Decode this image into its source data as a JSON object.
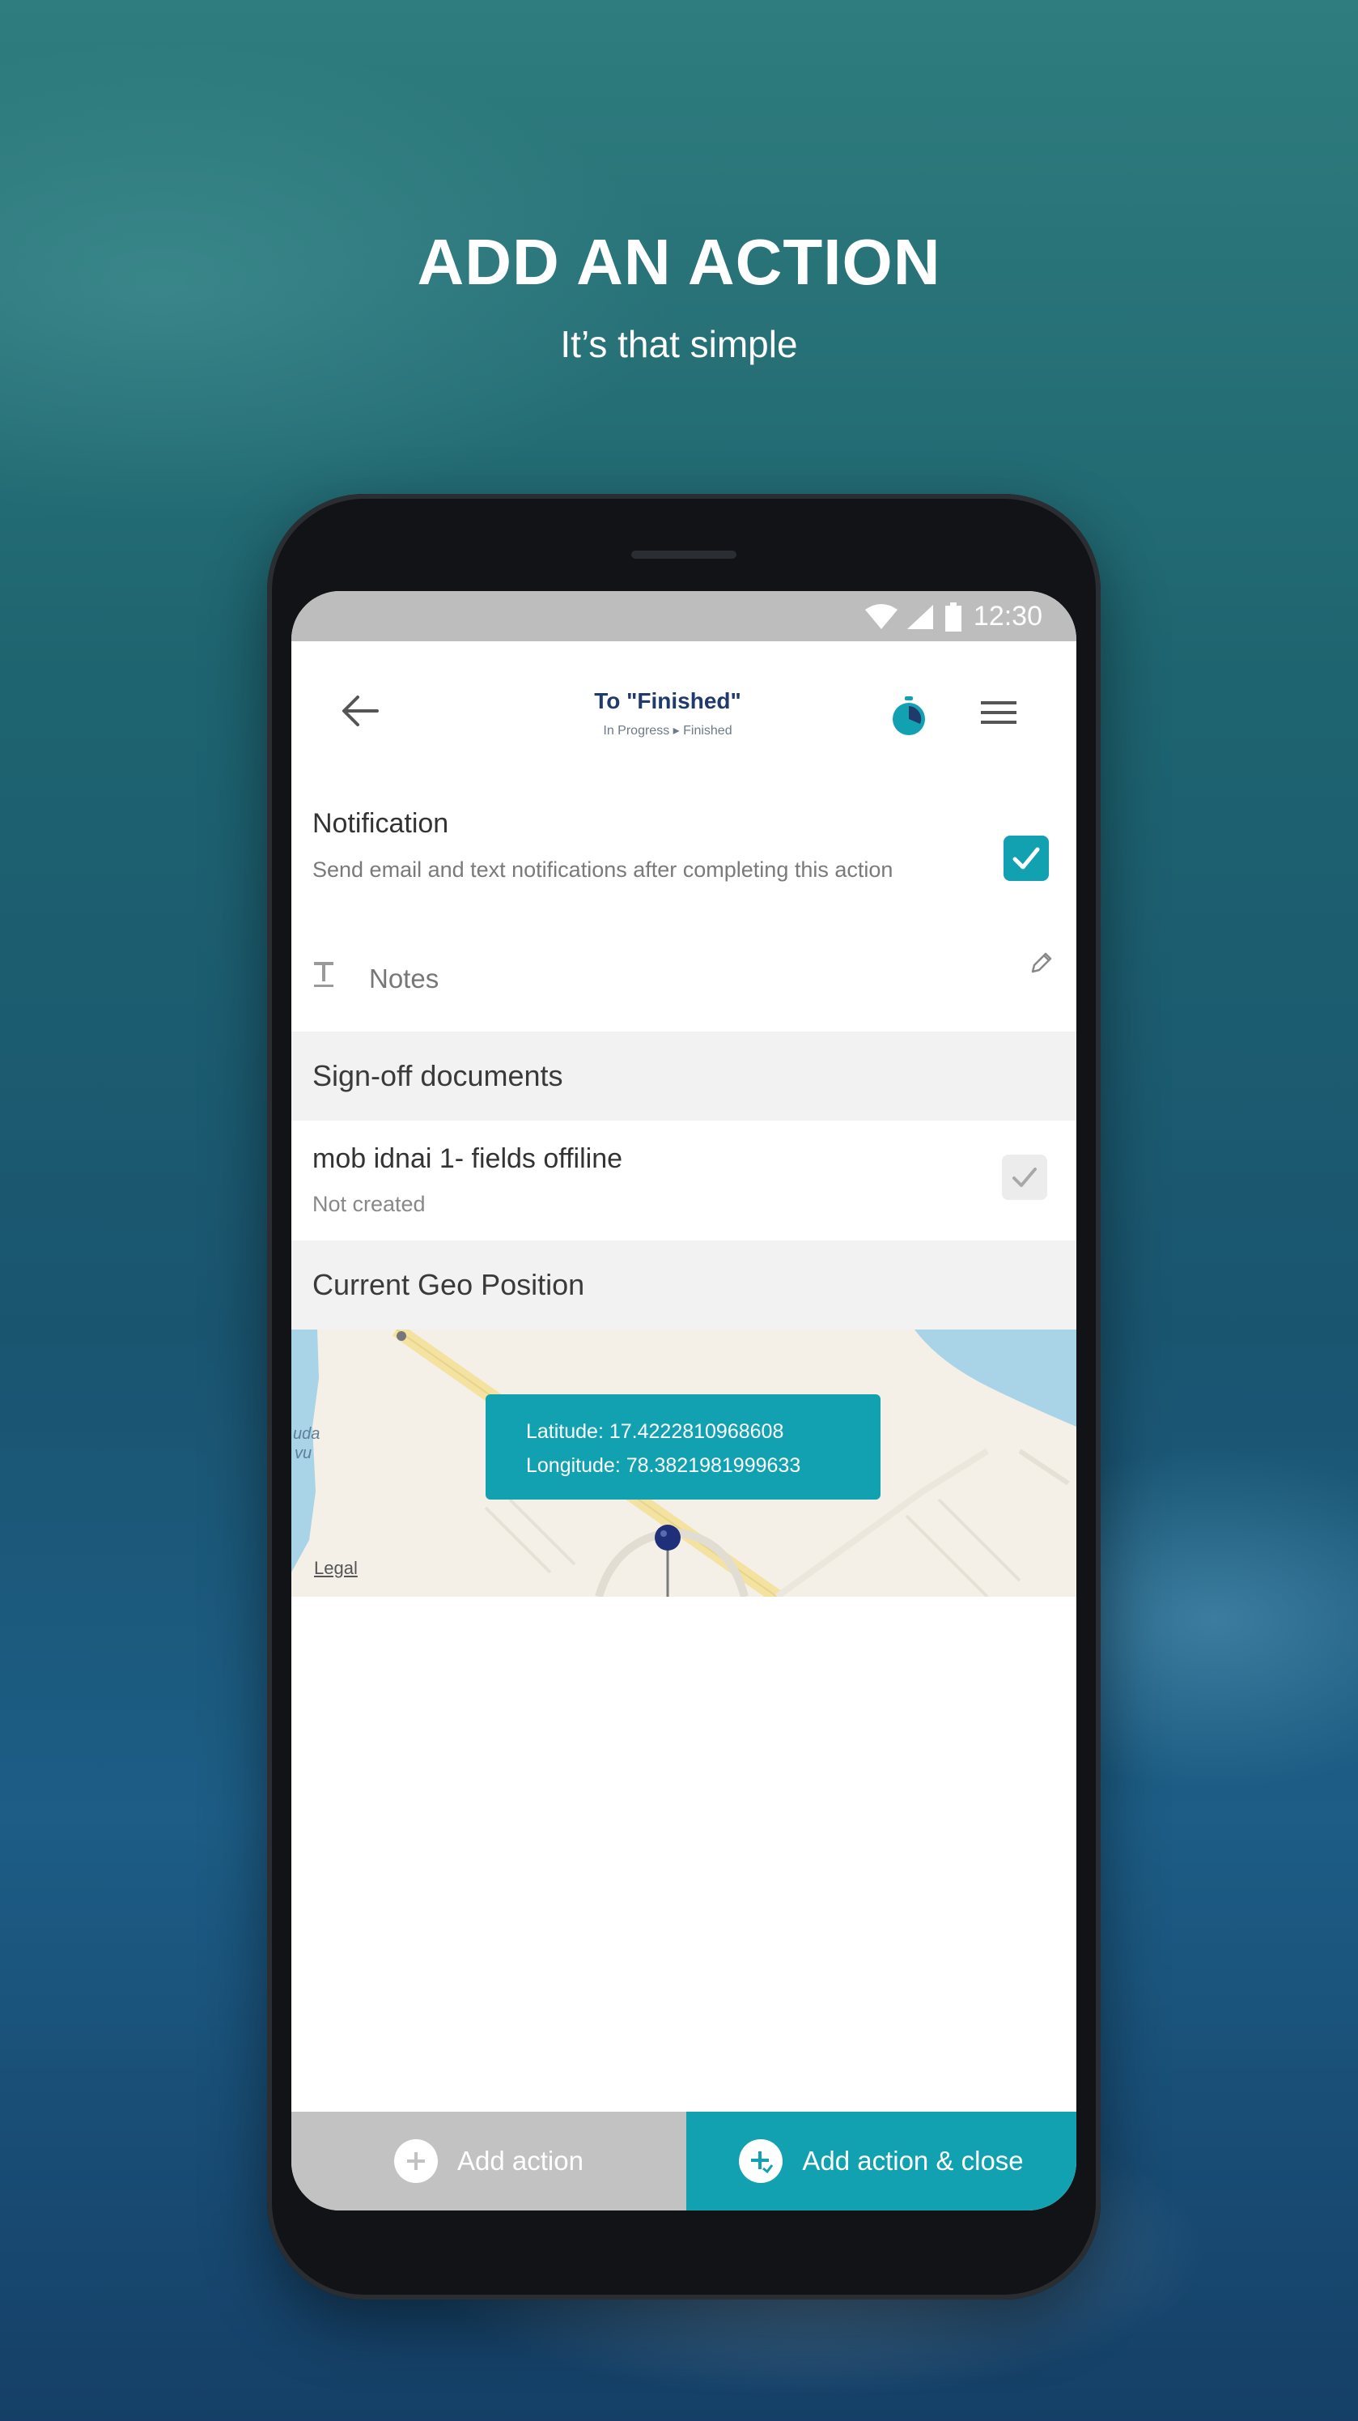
{
  "hero": {
    "title": "ADD AN ACTION",
    "subtitle": "It’s that simple"
  },
  "status_bar": {
    "time": "12:30",
    "icons": [
      "wifi-icon",
      "signal-icon",
      "battery-icon"
    ]
  },
  "app_bar": {
    "title": "To \"Finished\"",
    "breadcrumb_from": "In Progress",
    "breadcrumb_to": "Finished",
    "icons": [
      "back-arrow-icon",
      "timer-icon",
      "hamburger-menu-icon"
    ]
  },
  "notification": {
    "title": "Notification",
    "description": "Send email and text notifications after completing this action",
    "checked": true
  },
  "notes": {
    "label": "Notes",
    "icons": [
      "text-field-icon",
      "pencil-icon"
    ]
  },
  "signoff": {
    "heading": "Sign-off documents",
    "items": [
      {
        "title": "mob idnai 1- fields offiline",
        "status": "Not created",
        "checked": false
      }
    ]
  },
  "geo": {
    "heading": "Current Geo Position",
    "latitude_text": "Latitude: 17.4222810968608",
    "longitude_text": "Longitude: 78.3821981999633",
    "legal": "Legal",
    "map_labels": [
      "uda",
      "vu"
    ]
  },
  "bottom_bar": {
    "add_action": "Add action",
    "add_action_close": "Add action & close"
  },
  "colors": {
    "accent": "#12a1b1",
    "title_navy": "#1f3a6b",
    "button_gray": "#c2c2c2",
    "status_gray": "#bdbdbd"
  }
}
